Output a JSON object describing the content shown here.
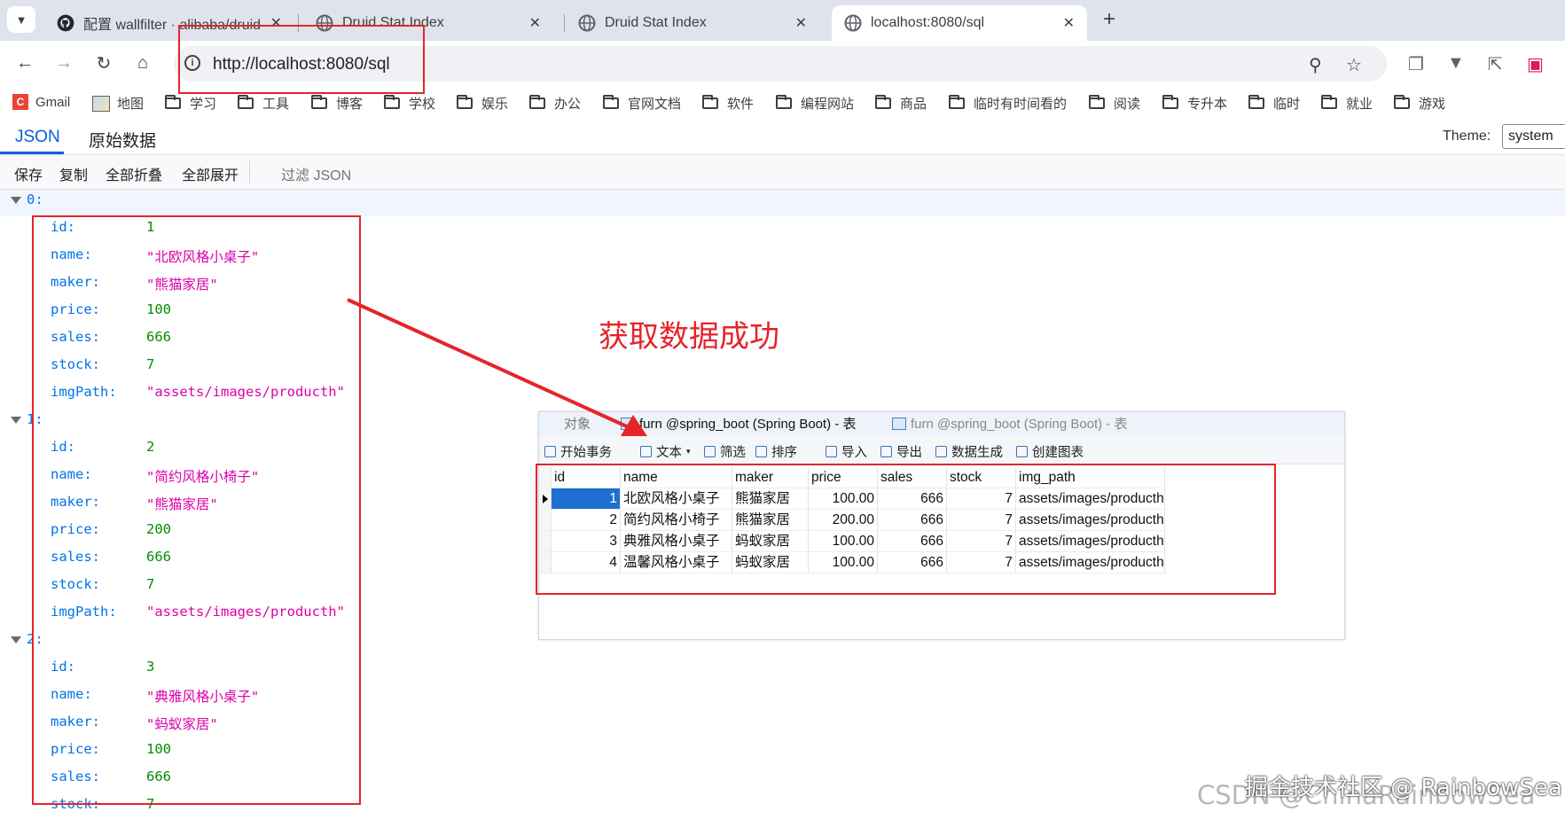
{
  "browser": {
    "tabs": [
      {
        "title": "配置 wallfilter · alibaba/druid",
        "icon": "github-icon",
        "active": false
      },
      {
        "title": "Druid Stat Index",
        "icon": "globe-icon",
        "active": false
      },
      {
        "title": "Druid Stat Index",
        "icon": "globe-icon",
        "active": false
      },
      {
        "title": "localhost:8080/sql",
        "icon": "globe-icon",
        "active": true
      }
    ],
    "url": "http://localhost:8080/sql"
  },
  "bookmarks": [
    "Gmail",
    "地图",
    "学习",
    "工具",
    "博客",
    "学校",
    "娱乐",
    "办公",
    "官网文档",
    "软件",
    "编程网站",
    "商品",
    "临时有时间看的",
    "阅读",
    "专升本",
    "临时",
    "就业",
    "游戏"
  ],
  "viewer": {
    "tabs": [
      "JSON",
      "原始数据"
    ],
    "tools": [
      "保存",
      "复制",
      "全部折叠",
      "全部展开"
    ],
    "filter_placeholder": "过滤 JSON",
    "theme_label": "Theme:",
    "theme_value": "system"
  },
  "json_tree": [
    {
      "index": "0:",
      "fields": [
        {
          "key": "id:",
          "value": "1",
          "kind": "num"
        },
        {
          "key": "name:",
          "value": "\"北欧风格小桌子\"",
          "kind": "str"
        },
        {
          "key": "maker:",
          "value": "\"熊猫家居\"",
          "kind": "str"
        },
        {
          "key": "price:",
          "value": "100",
          "kind": "num"
        },
        {
          "key": "sales:",
          "value": "666",
          "kind": "num"
        },
        {
          "key": "stock:",
          "value": "7",
          "kind": "num"
        },
        {
          "key": "imgPath:",
          "value": "\"assets/images/producth\"",
          "kind": "str"
        }
      ]
    },
    {
      "index": "1:",
      "fields": [
        {
          "key": "id:",
          "value": "2",
          "kind": "num"
        },
        {
          "key": "name:",
          "value": "\"简约风格小椅子\"",
          "kind": "str"
        },
        {
          "key": "maker:",
          "value": "\"熊猫家居\"",
          "kind": "str"
        },
        {
          "key": "price:",
          "value": "200",
          "kind": "num"
        },
        {
          "key": "sales:",
          "value": "666",
          "kind": "num"
        },
        {
          "key": "stock:",
          "value": "7",
          "kind": "num"
        },
        {
          "key": "imgPath:",
          "value": "\"assets/images/producth\"",
          "kind": "str"
        }
      ]
    },
    {
      "index": "2:",
      "fields": [
        {
          "key": "id:",
          "value": "3",
          "kind": "num"
        },
        {
          "key": "name:",
          "value": "\"典雅风格小桌子\"",
          "kind": "str"
        },
        {
          "key": "maker:",
          "value": "\"蚂蚁家居\"",
          "kind": "str"
        },
        {
          "key": "price:",
          "value": "100",
          "kind": "num"
        },
        {
          "key": "sales:",
          "value": "666",
          "kind": "num"
        },
        {
          "key": "stock:",
          "value": "7",
          "kind": "num"
        }
      ]
    }
  ],
  "annotation": {
    "text": "获取数据成功",
    "color": "#e5242b"
  },
  "navicat": {
    "tabs": [
      "对象",
      "furn @spring_boot (Spring Boot) - 表",
      "furn @spring_boot (Spring Boot) - 表"
    ],
    "tools": [
      "开始事务",
      "文本",
      "筛选",
      "排序",
      "导入",
      "导出",
      "数据生成",
      "创建图表"
    ],
    "columns": [
      "id",
      "name",
      "maker",
      "price",
      "sales",
      "stock",
      "img_path"
    ],
    "rows": [
      [
        "1",
        "北欧风格小桌子",
        "熊猫家居",
        "100.00",
        "666",
        "7",
        "assets/images/producth"
      ],
      [
        "2",
        "简约风格小椅子",
        "熊猫家居",
        "200.00",
        "666",
        "7",
        "assets/images/producth"
      ],
      [
        "3",
        "典雅风格小桌子",
        "蚂蚁家居",
        "100.00",
        "666",
        "7",
        "assets/images/producth"
      ],
      [
        "4",
        "温馨风格小桌子",
        "蚂蚁家居",
        "100.00",
        "666",
        "7",
        "assets/images/producth"
      ]
    ]
  },
  "watermark": "CSDN @ChinaRainbowSea",
  "watermark_overlay": "掘金技术社区 @ RainbowSea"
}
